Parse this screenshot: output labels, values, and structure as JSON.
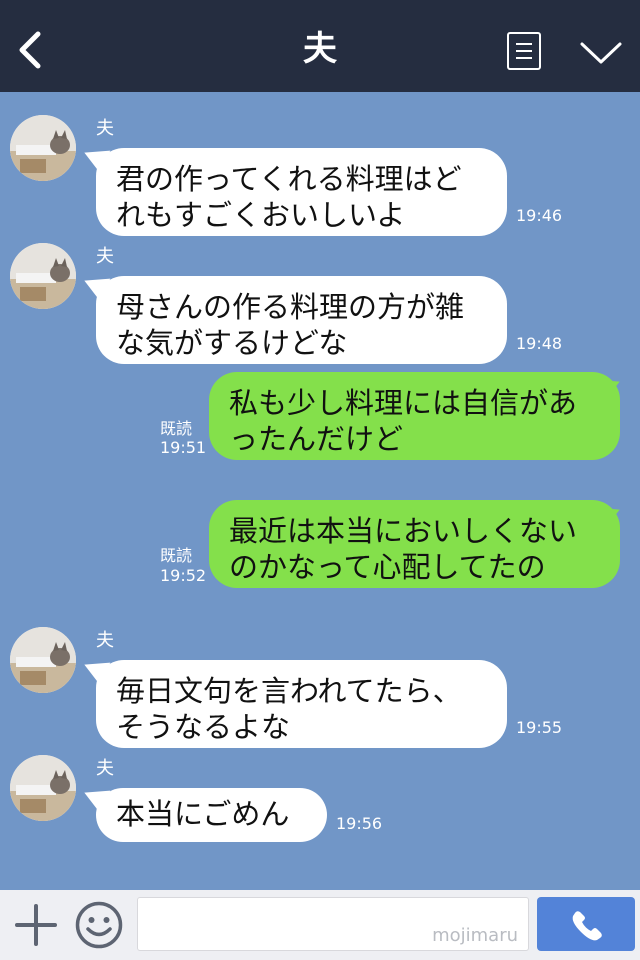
{
  "header": {
    "title": "夫",
    "back_icon": "chevron-left-icon",
    "menu_icon": "list-icon",
    "collapse_icon": "chevron-down-icon",
    "background_color": "#252d40"
  },
  "chat": {
    "background_color": "#7196c7",
    "incoming_bubble_color": "#ffffff",
    "outgoing_bubble_color": "#84e04b",
    "messages": [
      {
        "direction": "incoming",
        "sender": "夫",
        "text": "君の作ってくれる料理はど\nれもすごくおいしいよ",
        "time": "19:46"
      },
      {
        "direction": "incoming",
        "sender": "夫",
        "text": "母さんの作る料理の方が雑\nな気がするけどな",
        "time": "19:48"
      },
      {
        "direction": "outgoing",
        "read_label": "既読",
        "text": "私も少し料理には自信があ\nったんだけど",
        "time": "19:51"
      },
      {
        "direction": "outgoing",
        "read_label": "既読",
        "text": "最近は本当においしくない\nのかなって心配してたの",
        "time": "19:52"
      },
      {
        "direction": "incoming",
        "sender": "夫",
        "text": "毎日文句を言われてたら、\nそうなるよな",
        "time": "19:55"
      },
      {
        "direction": "incoming",
        "sender": "夫",
        "text": "本当にごめん",
        "time": "19:56"
      }
    ]
  },
  "footer": {
    "plus_icon": "plus-icon",
    "emoji_icon": "smiley-icon",
    "input_value": "",
    "watermark": "mojimaru",
    "send_icon": "phone-icon",
    "send_color": "#5383d8"
  }
}
